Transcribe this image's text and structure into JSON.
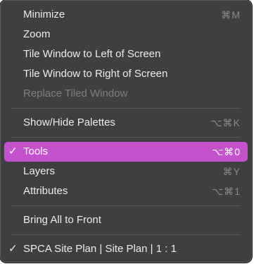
{
  "menu": {
    "items": [
      {
        "label": "Minimize",
        "shortcut": "⌘M"
      },
      {
        "label": "Zoom",
        "shortcut": ""
      },
      {
        "label": "Tile Window to Left of Screen",
        "shortcut": ""
      },
      {
        "label": "Tile Window to Right of Screen",
        "shortcut": ""
      },
      {
        "label": "Replace Tiled Window",
        "shortcut": "",
        "disabled": true
      },
      {
        "label": "Show/Hide Palettes",
        "shortcut": "⌥⌘K"
      },
      {
        "label": "Tools",
        "shortcut": "⌥⌘0",
        "checked": true,
        "highlighted": true
      },
      {
        "label": "Layers",
        "shortcut": "⌘Y"
      },
      {
        "label": "Attributes",
        "shortcut": "⌥⌘1"
      },
      {
        "label": "Bring All to Front",
        "shortcut": ""
      },
      {
        "label": "SPCA Site Plan | Site Plan | 1 : 1",
        "shortcut": "",
        "checked": true
      }
    ],
    "check_glyph": "✓",
    "highlight_color": "#c452cc",
    "background_color": "#3f3e41"
  }
}
